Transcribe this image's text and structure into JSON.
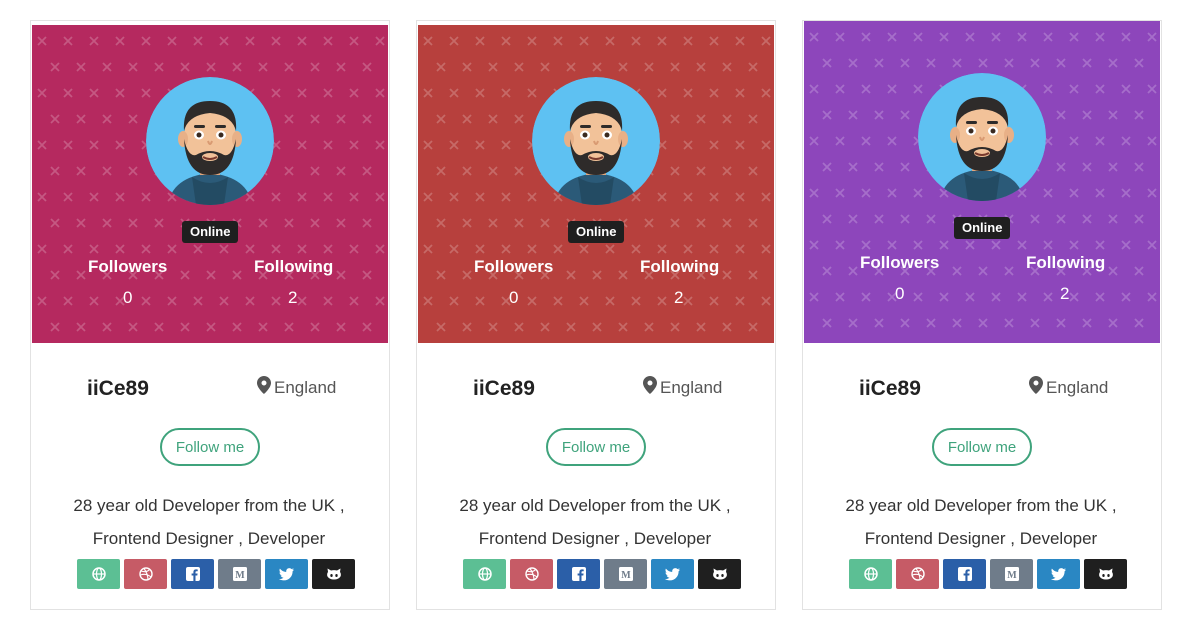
{
  "cards": [
    {
      "status": "Online",
      "followers_label": "Followers",
      "followers_count": "0",
      "following_label": "Following",
      "following_count": "2",
      "username": "iiCe89",
      "location": "England",
      "follow_label": "Follow me",
      "bio_line1": "28 year old Developer from the UK ,",
      "bio_line2": "Frontend Designer , Developer",
      "banner_color": "#b5295f"
    },
    {
      "status": "Online",
      "followers_label": "Followers",
      "followers_count": "0",
      "following_label": "Following",
      "following_count": "2",
      "username": "iiCe89",
      "location": "England",
      "follow_label": "Follow me",
      "bio_line1": "28 year old Developer from the UK ,",
      "bio_line2": "Frontend Designer , Developer",
      "banner_color": "#b7403d"
    },
    {
      "status": "Online",
      "followers_label": "Followers",
      "followers_count": "0",
      "following_label": "Following",
      "following_count": "2",
      "username": "iiCe89",
      "location": "England",
      "follow_label": "Follow me",
      "bio_line1": "28 year old Developer from the UK ,",
      "bio_line2": "Frontend Designer , Developer",
      "banner_color": "#8d46bb"
    }
  ],
  "social_icons": [
    {
      "name": "globe-icon",
      "color": "#5cbf94"
    },
    {
      "name": "dribbble-icon",
      "color": "#c65b66"
    },
    {
      "name": "facebook-icon",
      "color": "#2b5fa8"
    },
    {
      "name": "medium-icon",
      "color": "#6f7c8a"
    },
    {
      "name": "twitter-icon",
      "color": "#2a87c3"
    },
    {
      "name": "github-icon",
      "color": "#1f1f1f"
    }
  ],
  "colors": {
    "accent": "#3fa37c",
    "badge_bg": "#1f1f1f"
  }
}
